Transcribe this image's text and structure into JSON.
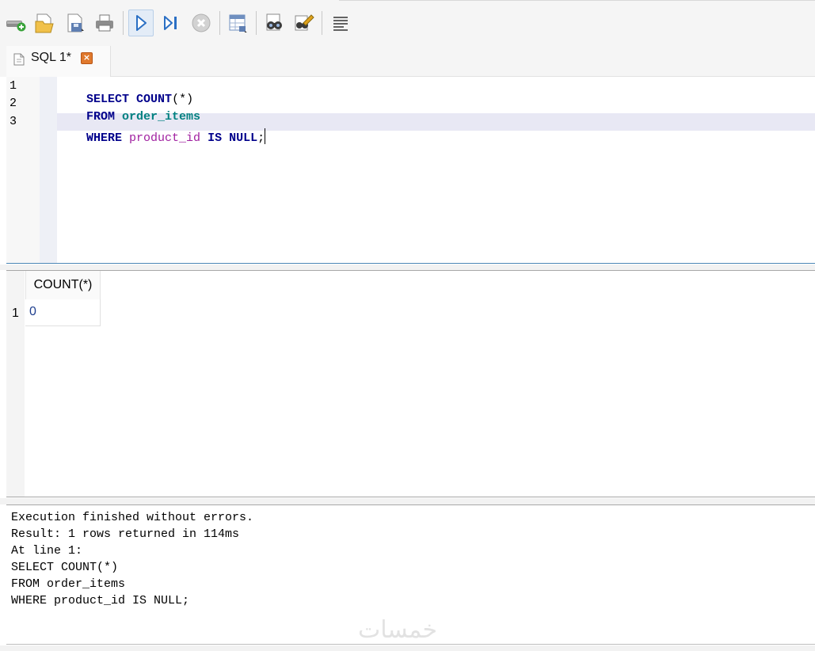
{
  "toolbar": {
    "buttons": [
      {
        "name": "open-database-icon"
      },
      {
        "name": "open-sql-file-icon"
      },
      {
        "name": "save-sql-file-icon"
      },
      {
        "name": "print-icon"
      },
      {
        "name": "execute-all-icon"
      },
      {
        "name": "execute-current-line-icon"
      },
      {
        "name": "stop-execution-icon"
      },
      {
        "name": "save-results-view-icon"
      },
      {
        "name": "find-icon"
      },
      {
        "name": "find-replace-icon"
      },
      {
        "name": "wrap-text-icon"
      }
    ]
  },
  "tab": {
    "label": "SQL 1*",
    "close_glyph": "×"
  },
  "editor": {
    "line_numbers": [
      "1",
      "2",
      "3"
    ],
    "lines": [
      [
        {
          "t": "SELECT",
          "c": "kw"
        },
        {
          "t": " ",
          "c": "punc"
        },
        {
          "t": "COUNT",
          "c": "kw"
        },
        {
          "t": "(*)",
          "c": "punc"
        }
      ],
      [
        {
          "t": "FROM",
          "c": "kw"
        },
        {
          "t": " ",
          "c": "punc"
        },
        {
          "t": "order_items",
          "c": "tbl"
        }
      ],
      [
        {
          "t": "WHERE",
          "c": "kw"
        },
        {
          "t": " ",
          "c": "punc"
        },
        {
          "t": "product_id",
          "c": "col"
        },
        {
          "t": " ",
          "c": "punc"
        },
        {
          "t": "IS",
          "c": "kw"
        },
        {
          "t": " ",
          "c": "punc"
        },
        {
          "t": "NULL",
          "c": "kw"
        },
        {
          "t": ";",
          "c": "punc"
        }
      ]
    ]
  },
  "results": {
    "columns": [
      "COUNT(*)"
    ],
    "rows": [
      {
        "num": "1",
        "cells": [
          "0"
        ]
      }
    ]
  },
  "messages": {
    "lines": [
      "Execution finished without errors.",
      "Result: 1 rows returned in 114ms",
      "At line 1:",
      "SELECT COUNT(*)",
      "FROM order_items",
      "WHERE product_id IS NULL;"
    ]
  },
  "watermark": "خمسات"
}
